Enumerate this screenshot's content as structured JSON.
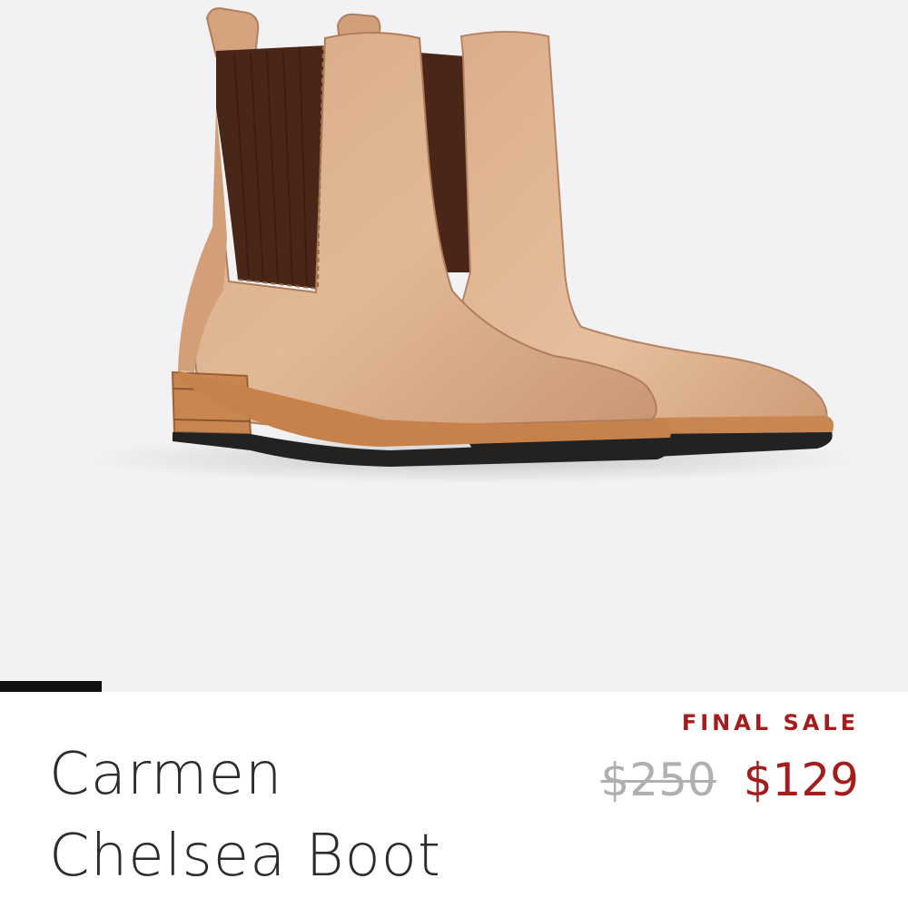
{
  "product": {
    "image_alt": "Carmen Chelsea Boot product photo",
    "title": "Carmen\nChelsea Boot",
    "badge": "FINAL SALE",
    "price_original": "$250",
    "price_sale": "$129"
  },
  "carousel": {
    "active_index": 1
  },
  "colors": {
    "hero_background": "#f2f2f4",
    "sale_red": "#a41d1d",
    "strike_gray": "#b0b0b0",
    "title_text": "#2c2c2c",
    "leather_tan": "#d7a57e",
    "elastic_brown": "#4a2618",
    "sole_black": "#222222"
  }
}
